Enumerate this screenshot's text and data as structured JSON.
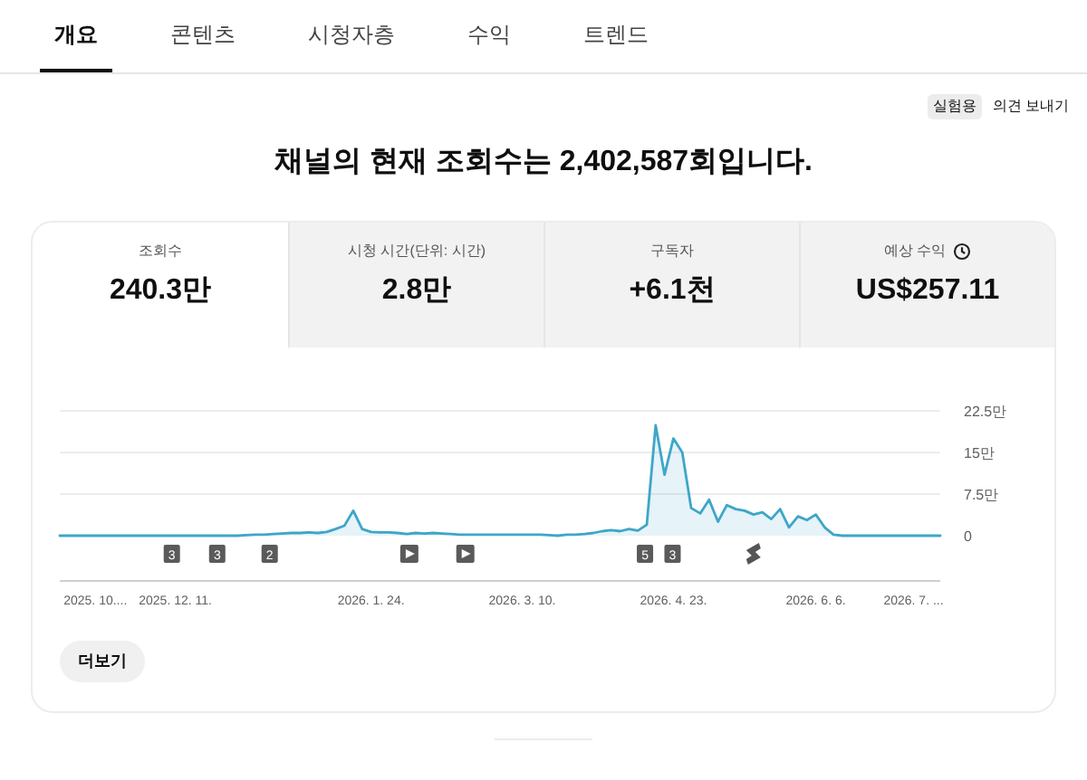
{
  "tabs": [
    {
      "label": "개요",
      "selected": true
    },
    {
      "label": "콘텐츠",
      "selected": false
    },
    {
      "label": "시청자층",
      "selected": false
    },
    {
      "label": "수익",
      "selected": false
    },
    {
      "label": "트렌드",
      "selected": false
    }
  ],
  "badge": "실험용",
  "feedback": "의견 보내기",
  "headline": "채널의 현재 조회수는 2,402,587회입니다.",
  "metrics": [
    {
      "label": "조회수",
      "value": "240.3만",
      "selected": true,
      "clock": false
    },
    {
      "label": "시청 시간(단위: 시간)",
      "value": "2.8만",
      "selected": false,
      "clock": false
    },
    {
      "label": "구독자",
      "value": "+6.1천",
      "selected": false,
      "clock": false
    },
    {
      "label": "예상 수익",
      "value": "US$257.11",
      "selected": false,
      "clock": true
    }
  ],
  "chart_data": {
    "type": "area",
    "ylim": [
      0,
      22.5
    ],
    "yticks": [
      {
        "value": 0,
        "label": "0"
      },
      {
        "value": 7.5,
        "label": "7.5만"
      },
      {
        "value": 15,
        "label": "15만"
      },
      {
        "value": 22.5,
        "label": "22.5만"
      }
    ],
    "categories": [
      null,
      null,
      null,
      null,
      "2025. 10....",
      null,
      null,
      null,
      null,
      null,
      null,
      null,
      null,
      "2025. 12. 11.",
      null,
      null,
      null,
      null,
      null,
      null,
      null,
      null,
      null,
      null,
      null,
      null,
      null,
      null,
      null,
      null,
      null,
      null,
      null,
      null,
      null,
      "2026. 1. 24.",
      null,
      null,
      null,
      null,
      null,
      null,
      null,
      null,
      null,
      null,
      null,
      null,
      null,
      null,
      null,
      null,
      "2026. 3. 10.",
      null,
      null,
      null,
      null,
      null,
      null,
      null,
      null,
      null,
      null,
      null,
      null,
      null,
      null,
      null,
      null,
      "2026. 4. 23.",
      null,
      null,
      null,
      null,
      null,
      null,
      null,
      null,
      null,
      null,
      null,
      null,
      null,
      null,
      null,
      "2026. 6. 6.",
      null,
      null,
      null,
      null,
      null,
      null,
      null,
      null,
      null,
      null,
      "2026. 7. ...",
      null,
      null,
      null
    ],
    "series": [
      {
        "color": "#3ea6c8",
        "values": [
          0,
          0,
          0,
          0,
          0,
          0,
          0,
          0,
          0,
          0,
          0,
          0,
          0,
          0,
          0,
          0,
          0,
          0,
          0,
          0,
          0,
          0.1,
          0.2,
          0.2,
          0.3,
          0.4,
          0.5,
          0.5,
          0.6,
          0.5,
          0.7,
          1.2,
          1.8,
          4.5,
          1.2,
          0.7,
          0.6,
          0.6,
          0.5,
          0.3,
          0.5,
          0.4,
          0.5,
          0.4,
          0.3,
          0.2,
          0.2,
          0.2,
          0.2,
          0.2,
          0.2,
          0.2,
          0.2,
          0.2,
          0.2,
          0.1,
          0,
          0.2,
          0.2,
          0.3,
          0.5,
          0.8,
          1,
          0.8,
          1.2,
          0.9,
          2,
          19.9,
          11,
          17.5,
          15,
          5,
          4,
          6.5,
          2.5,
          5.5,
          4.8,
          4.5,
          3.8,
          4.2,
          3,
          4.8,
          1.5,
          3.5,
          2.8,
          3.8,
          1.5,
          0.2,
          0,
          0,
          0,
          0,
          0,
          0,
          0,
          0,
          0,
          0,
          0,
          0
        ]
      }
    ]
  },
  "markers": [
    {
      "kind": "count",
      "text": "3"
    },
    {
      "kind": "count",
      "text": "3"
    },
    {
      "kind": "count",
      "text": "2"
    },
    {
      "kind": "video"
    },
    {
      "kind": "video"
    },
    {
      "kind": "count",
      "text": "5"
    },
    {
      "kind": "count",
      "text": "3"
    },
    {
      "kind": "short"
    }
  ],
  "more_button": "더보기"
}
